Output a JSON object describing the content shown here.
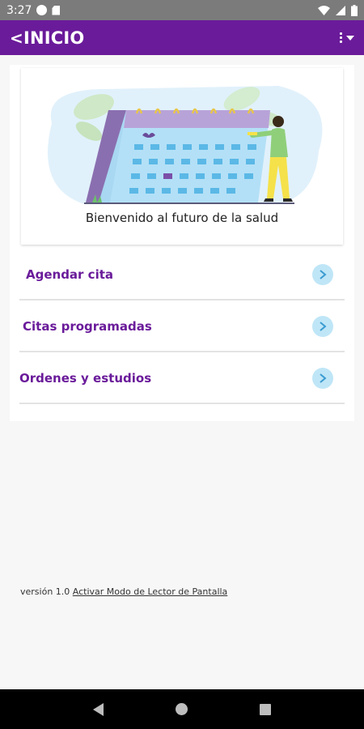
{
  "status_bar": {
    "time": "3:27",
    "icons": [
      "notification-circle-icon",
      "sd-card-icon",
      "wifi-icon",
      "signal-icon",
      "battery-icon"
    ]
  },
  "app_bar": {
    "title": "INICIO",
    "back_icon": "chevron-left-icon",
    "menu_icon": "overflow-menu-icon",
    "color": "#6a1b9a"
  },
  "hero": {
    "caption": "Bienvenido al futuro de la salud",
    "illustration": "calendar-person-illustration"
  },
  "menu": {
    "items": [
      {
        "label": "Agendar cita",
        "icon": "chevron-right-icon"
      },
      {
        "label": "Citas programadas",
        "icon": "chevron-right-icon"
      },
      {
        "label": "Ordenes y estudios",
        "icon": "chevron-right-icon"
      }
    ],
    "accent": "#6a1b9a",
    "arrow_bg": "#bfe6f7"
  },
  "footer": {
    "version_text": "versión 1.0",
    "screen_reader_link": "Activar Modo de Lector de Pantalla"
  },
  "nav_bar": {
    "icons": [
      "back-triangle-icon",
      "home-circle-icon",
      "recents-square-icon"
    ]
  }
}
